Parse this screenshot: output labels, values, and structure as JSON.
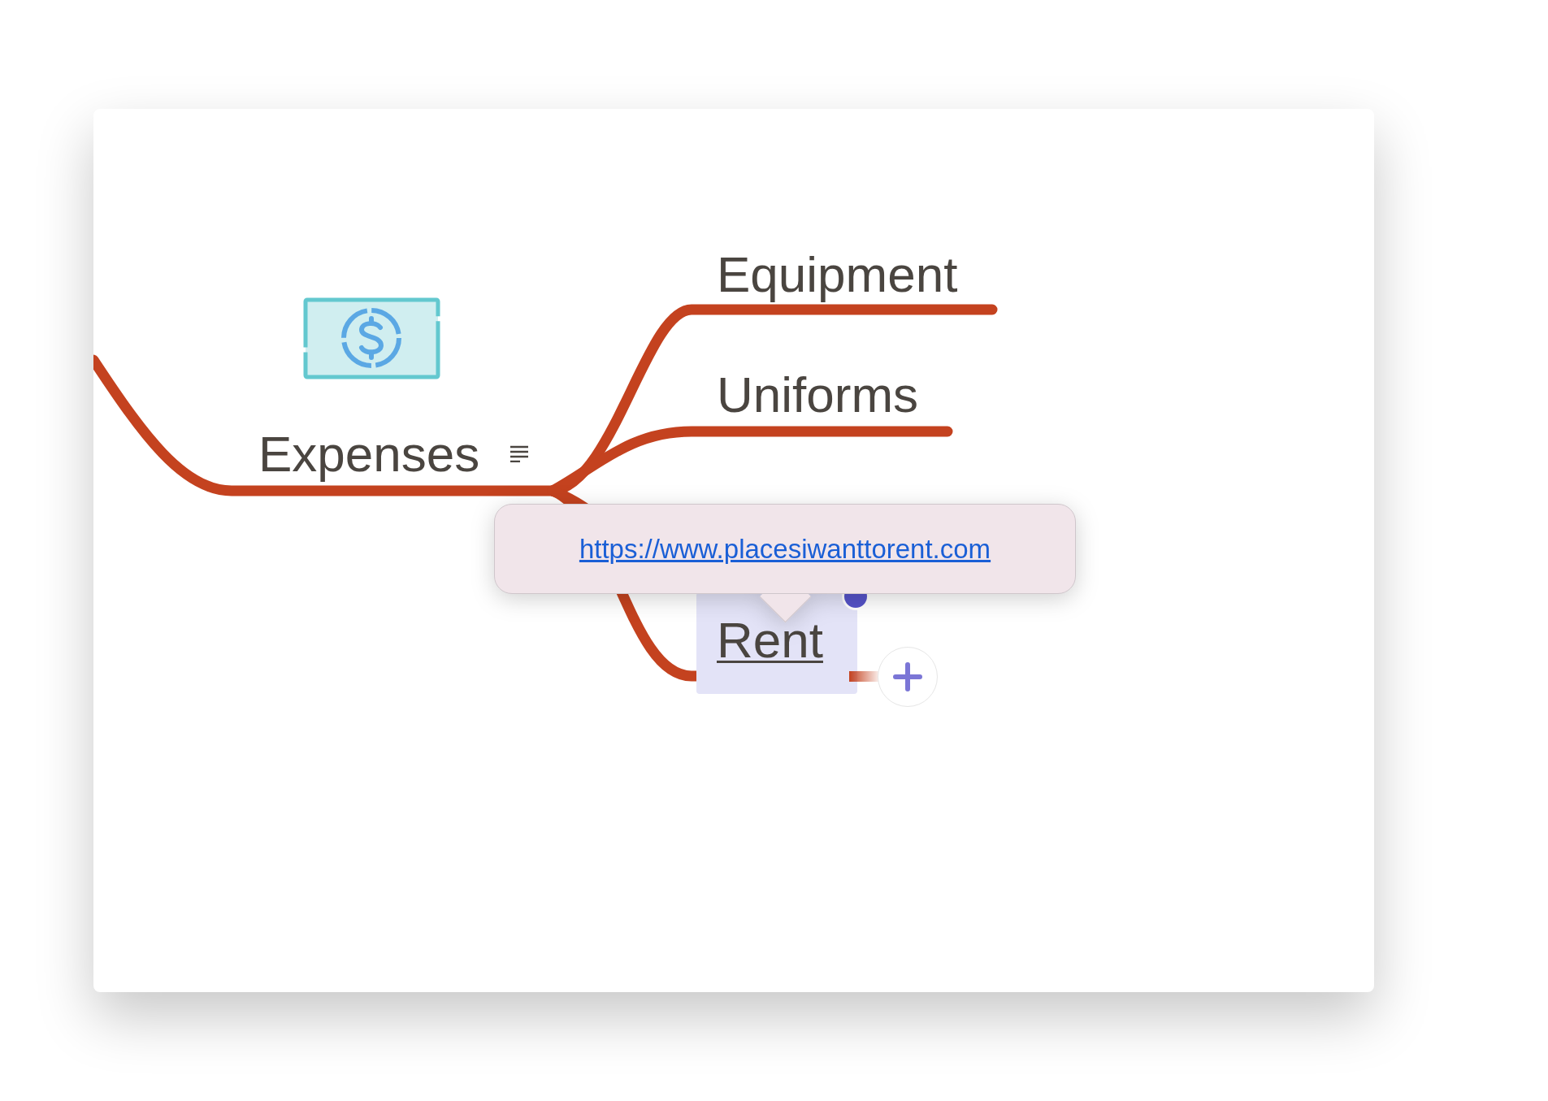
{
  "mind_map": {
    "topic": {
      "label": "Expenses",
      "has_notes": true,
      "children": [
        {
          "kind": "topic",
          "label": "Equipment",
          "selected": false,
          "has_link": false
        },
        {
          "kind": "topic",
          "label": "Uniforms",
          "selected": false,
          "has_link": false
        },
        {
          "kind": "branch"
        },
        {
          "kind": "topic",
          "label": "Rent",
          "selected": true,
          "has_link": true
        }
      ]
    }
  },
  "tooltip": {
    "link": "https://www.placesiwanttorent.com"
  }
}
